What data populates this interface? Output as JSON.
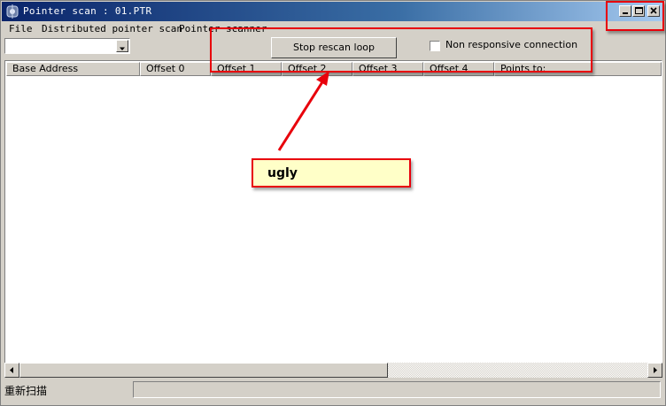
{
  "window": {
    "title": "Pointer scan : 01.PTR",
    "controls": [
      "minimize-icon",
      "maximize-icon",
      "close-icon"
    ]
  },
  "menu": {
    "items": [
      "File",
      "Distributed pointer scan",
      "Pointer scanner"
    ]
  },
  "toolbar": {
    "combo_value": "",
    "stop_button_label": "Stop rescan loop",
    "checkbox_label": "Non responsive connection",
    "checkbox_checked": false
  },
  "table": {
    "columns": [
      "Base Address",
      "Offset 0",
      "Offset 1",
      "Offset 2",
      "Offset 3",
      "Offset 4",
      "Points to:"
    ],
    "rows": []
  },
  "scrollbar": {
    "position_fraction": 0.0
  },
  "status": {
    "text": "重新扫描",
    "progress_fraction": 0.0
  },
  "annotation": {
    "callout_text": "ugly",
    "color": "#e8000b",
    "callout_bg": "#ffffc8"
  },
  "colors": {
    "titlebar_start": "#0a246a",
    "titlebar_end": "#a6caf0",
    "face": "#d4d0c8"
  }
}
